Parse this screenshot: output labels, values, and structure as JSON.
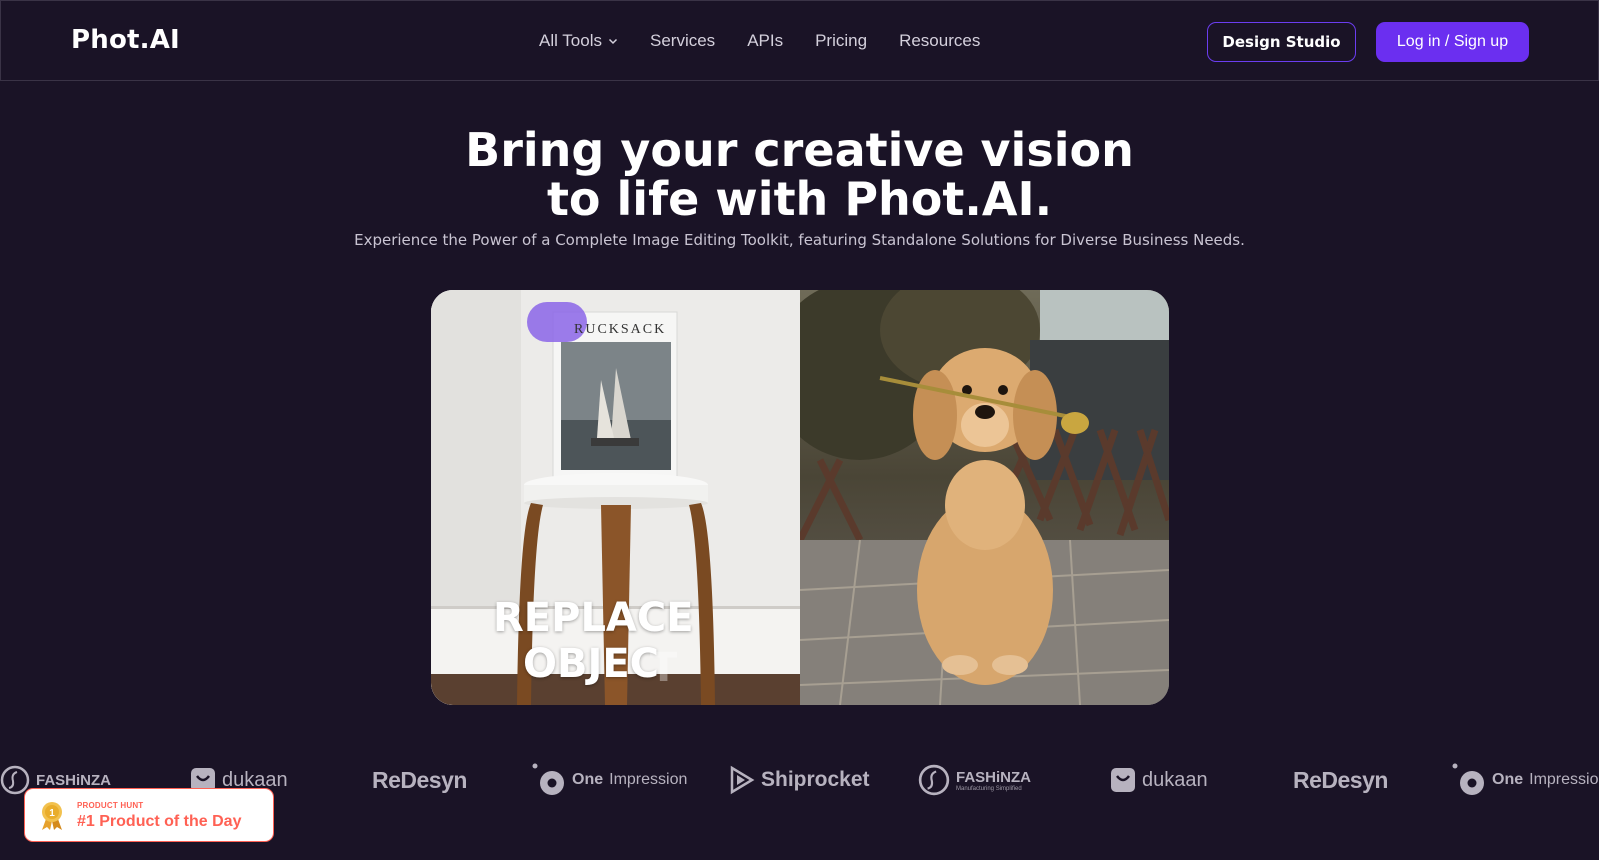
{
  "header": {
    "logo": "Phot.AI",
    "nav": [
      "All Tools",
      "Services",
      "APIs",
      "Pricing",
      "Resources"
    ],
    "design_studio": "Design Studio",
    "login": "Log in / Sign up"
  },
  "hero": {
    "title_line1": "Bring your creative vision",
    "title_line2": "to life with Phot.AI.",
    "subtitle": "Experience the Power of a Complete Image Editing Toolkit, featuring Standalone Solutions for Diverse Business Needs."
  },
  "showcase": {
    "magazine_title": "RUCKSACK",
    "overlay_line1": "REPLACE",
    "overlay_line2": "OBJEC",
    "overlay_ghost": "T"
  },
  "brands": {
    "fashinza": "FASHiNZA",
    "fashinza_sub": "Manufacturing Simplified",
    "dukaan": "dukaan",
    "redesyn": "ReDesyn",
    "one_impression_a": "One",
    "one_impression_b": "Impression",
    "shiprocket": "Shiprocket"
  },
  "badge": {
    "kicker": "PRODUCT HUNT",
    "title": "#1 Product of the Day",
    "rank": "1"
  },
  "colors": {
    "background": "#1a1326",
    "accent": "#6b2ff0",
    "product_hunt": "#ff6154"
  }
}
